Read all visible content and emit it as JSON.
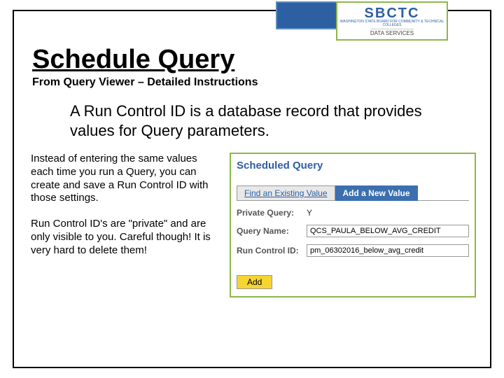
{
  "header": {
    "logo_name": "SBCTC",
    "logo_sub": "WASHINGTON STATE BOARD FOR COMMUNITY & TECHNICAL COLLEGES",
    "logo_service": "DATA SERVICES"
  },
  "title": {
    "main": "Schedule Query",
    "sub": "From Query Viewer – Detailed Instructions"
  },
  "intro": "A Run Control ID is a database record that provides values for Query parameters.",
  "body": {
    "p1": "Instead of entering the same values each time you run a Query, you can create and save a Run Control ID with those settings.",
    "p2": "Run Control ID's are \"private\" and are only visible to you.  Careful though! It is very hard to delete them!"
  },
  "panel": {
    "title": "Scheduled Query",
    "tabs": {
      "existing": "Find an Existing Value",
      "new": "Add a New Value"
    },
    "form": {
      "private_label": "Private Query:",
      "private_value": "Y",
      "queryname_label": "Query Name:",
      "queryname_value": "QCS_PAULA_BELOW_AVG_CREDIT",
      "runcontrol_label": "Run Control ID:",
      "runcontrol_value": "pm_06302016_below_avg_credit"
    },
    "add_button": "Add"
  }
}
